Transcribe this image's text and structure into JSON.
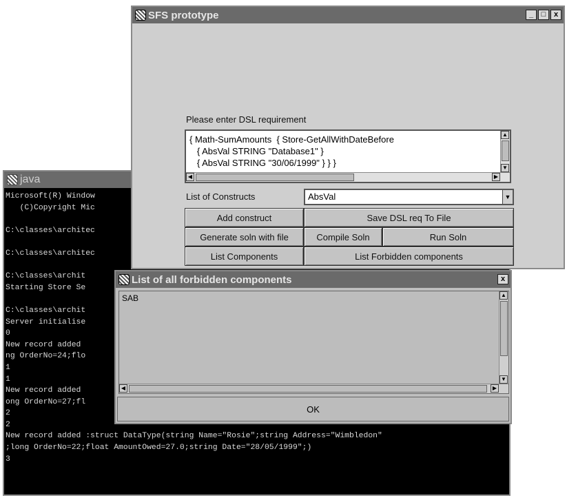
{
  "console": {
    "title": "java",
    "lines": [
      "Microsoft(R) Window",
      "   (C)Copyright Mic",
      "",
      "C:\\classes\\architec",
      "",
      "C:\\classes\\architec",
      "",
      "C:\\classes\\archit",
      "Starting Store Se",
      "",
      "C:\\classes\\archit",
      "Server initialise",
      "0",
      "New record added",
      "ng OrderNo=24;flo",
      "1",
      "1",
      "New record added",
      "ong OrderNo=27;fl",
      "2",
      "2",
      "New record added :struct DataType(string Name=\"Rosie\";string Address=\"Wimbledon\"",
      ";long OrderNo=22;float AmountOwed=27.0;string Date=\"28/05/1999\";)",
      "3"
    ]
  },
  "sfs": {
    "title": "SFS prototype",
    "window_buttons": {
      "minimize": "_",
      "maximize": "□",
      "close": "x"
    },
    "prompt_label": "Please enter DSL requirement",
    "dsl_text": "{ Math-SumAmounts  { Store-GetAllWithDateBefore\n   { AbsVal STRING \"Database1\" }\n   { AbsVal STRING \"30/06/1999\" } } }",
    "constructs_label": "List of Constructs",
    "constructs_selected": "AbsVal",
    "buttons": {
      "add_construct": "Add construct",
      "save_dsl": "Save DSL req To File",
      "generate_soln": "Generate soln with file",
      "compile_soln": "Compile Soln",
      "run_soln": "Run Soln",
      "list_components": "List Components",
      "list_forbidden": "List Forbidden components"
    }
  },
  "forbidden": {
    "title": "List of all forbidden components",
    "close": "x",
    "items": [
      "SAB"
    ],
    "ok_label": "OK"
  }
}
